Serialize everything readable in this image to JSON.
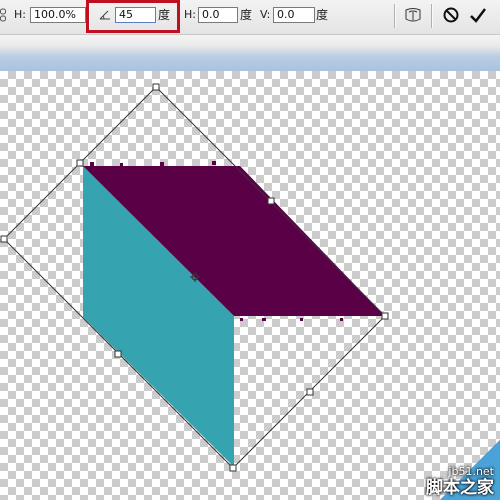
{
  "toolbar": {
    "height_label": "H:",
    "height_percent": "100.0%",
    "rotate_value": "45",
    "rotate_unit": "度",
    "skew_h_label": "H:",
    "skew_h_value": "0.0",
    "skew_h_unit": "度",
    "skew_v_label": "V:",
    "skew_v_value": "0.0",
    "skew_v_unit": "度",
    "icons": [
      "link-icon",
      "angle-icon",
      "warp-icon",
      "cancel-icon",
      "commit-icon"
    ]
  },
  "canvas": {
    "colors": {
      "top_face": "#5a0046",
      "side_face": "#36a3b0",
      "highlight_box": "#c0101f",
      "checker": "#cccccc"
    }
  },
  "watermark": {
    "url": "jb51.net",
    "name": "脚本之家"
  }
}
